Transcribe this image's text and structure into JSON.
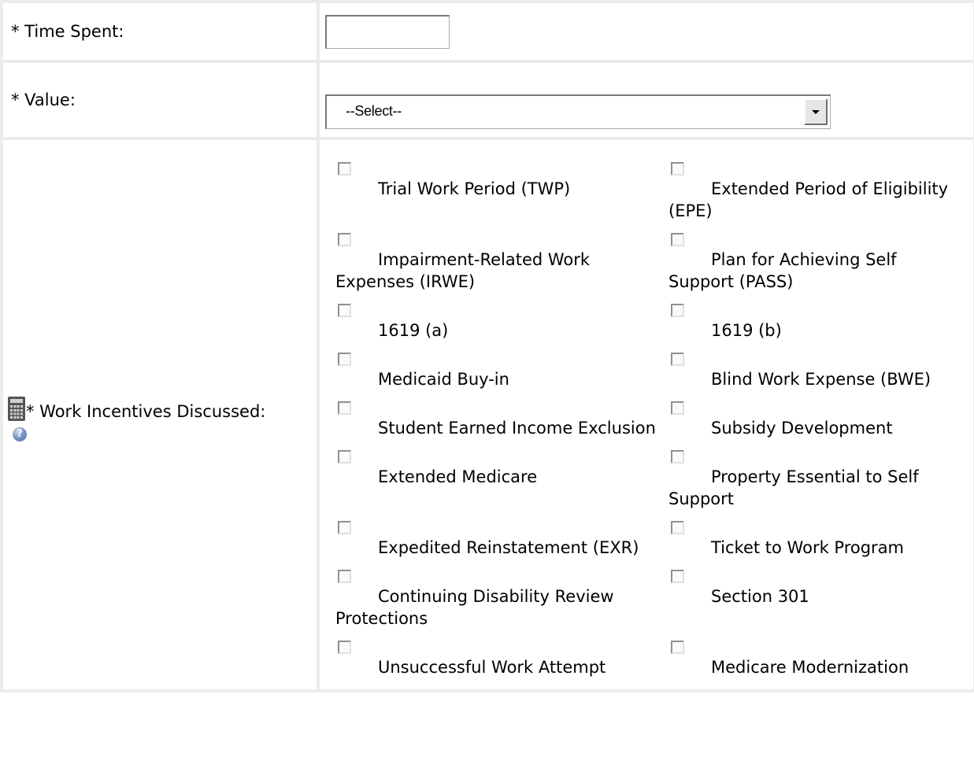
{
  "time_spent": {
    "label": "* Time Spent:",
    "value": "",
    "placeholder": ""
  },
  "value_field": {
    "label": "* Value:",
    "selected": "--Select--"
  },
  "work_incentives": {
    "label": "* Work Incentives Discussed:",
    "calculator_icon": "calculator-icon",
    "help_icon": "help-icon",
    "help_glyph": "?",
    "options": [
      {
        "label": "Trial Work Period (TWP)",
        "checked": false
      },
      {
        "label": "Extended Period of Eligibility (EPE)",
        "checked": false
      },
      {
        "label": "Impairment-Related Work Expenses (IRWE)",
        "checked": false
      },
      {
        "label": "Plan for Achieving Self Support (PASS)",
        "checked": false
      },
      {
        "label": "1619 (a)",
        "checked": false
      },
      {
        "label": "1619 (b)",
        "checked": false
      },
      {
        "label": "Medicaid Buy-in",
        "checked": false
      },
      {
        "label": "Blind Work Expense (BWE)",
        "checked": false
      },
      {
        "label": "Student Earned Income Exclusion",
        "checked": false
      },
      {
        "label": "Subsidy Development",
        "checked": false
      },
      {
        "label": "Extended Medicare",
        "checked": false
      },
      {
        "label": "Property Essential to Self Support",
        "checked": false
      },
      {
        "label": "Expedited Reinstatement (EXR)",
        "checked": false
      },
      {
        "label": "Ticket to Work Program",
        "checked": false
      },
      {
        "label": "Continuing Disability Review Protections",
        "checked": false
      },
      {
        "label": "Section 301",
        "checked": false
      },
      {
        "label": "Unsuccessful Work Attempt",
        "checked": false
      },
      {
        "label": "Medicare Modernization",
        "checked": false
      }
    ]
  },
  "colors": {
    "border": "#ececec",
    "background": "#ffffff",
    "text": "#000000"
  }
}
